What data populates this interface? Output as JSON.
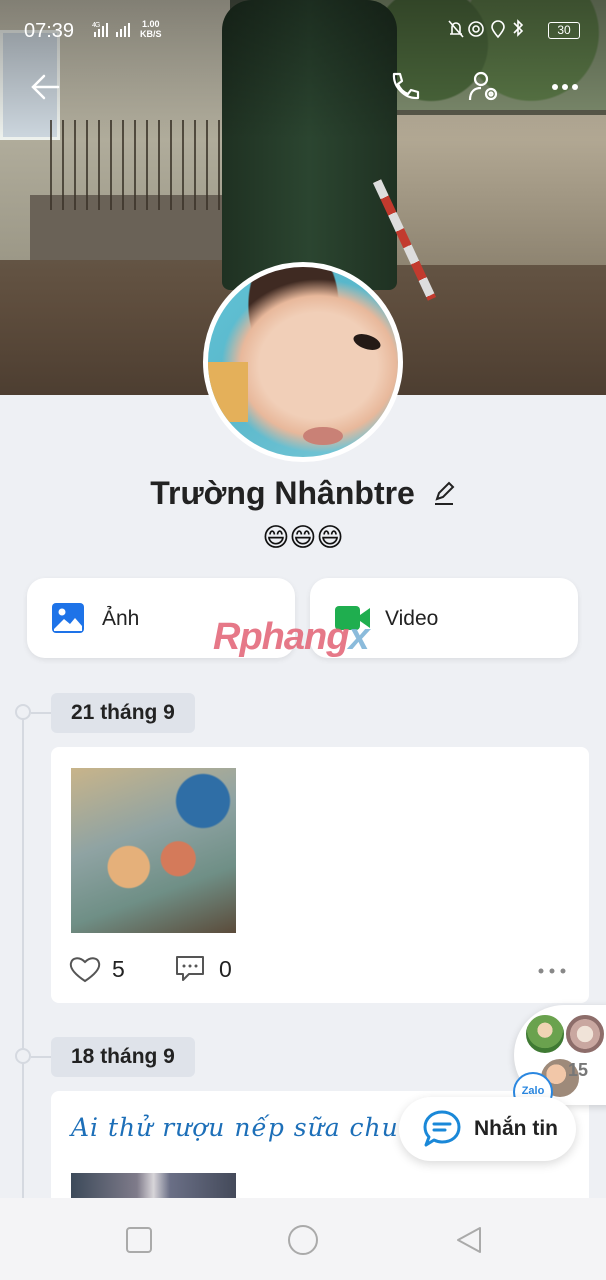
{
  "status_bar": {
    "time": "07:39",
    "network": "4G",
    "speed_value": "1.00",
    "speed_unit": "KB/S",
    "battery": "30"
  },
  "profile": {
    "name": "Trường Nhânbtre",
    "bio": "😄😄😄"
  },
  "quick_buttons": {
    "photos_label": "Ảnh",
    "video_label": "Video"
  },
  "watermark": {
    "main": "Rphang",
    "tail": "x"
  },
  "timeline": [
    {
      "date": "21 tháng 9",
      "likes": "5",
      "comments": "0"
    },
    {
      "date": "18 tháng 9",
      "text": "Ai thử rượu nếp sữa chua 😋"
    }
  ],
  "chat_bubbles": {
    "count": "15",
    "app": "Zalo"
  },
  "message_button": {
    "label": "Nhắn tin"
  },
  "colors": {
    "accent_blue": "#1d6fb8",
    "photo_icon_blue": "#1e73e8",
    "video_icon_green": "#1fae4f"
  },
  "icons": [
    "back-arrow-icon",
    "phone-icon",
    "user-settings-icon",
    "more-icon",
    "edit-pencil-icon",
    "image-icon",
    "video-camera-icon",
    "heart-icon",
    "comment-icon",
    "chat-bubble-icon",
    "square-nav-icon",
    "circle-nav-icon",
    "triangle-nav-icon"
  ]
}
